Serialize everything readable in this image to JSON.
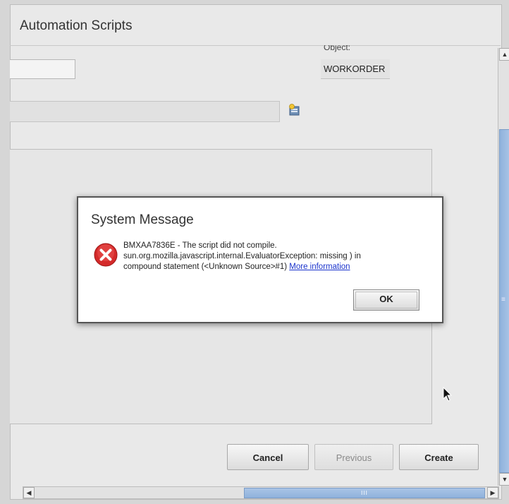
{
  "app": {
    "title": "Automation Scripts"
  },
  "form": {
    "object_label": "Object:",
    "object_value": "WORKORDER",
    "small_input_value": "",
    "wide_input_value": "",
    "source_text": ""
  },
  "footer": {
    "cancel_label": "Cancel",
    "previous_label": "Previous",
    "create_label": "Create"
  },
  "dialog": {
    "title": "System Message",
    "message_line1": "BMXAA7836E - The script did not compile.",
    "message_line2": "sun.org.mozilla.javascript.internal.EvaluatorException: missing ) in",
    "message_line3": "compound statement (<Unknown Source>#1)",
    "more_info_link": "More information",
    "ok_label": "OK"
  },
  "scrollbars": {
    "vertical_grip": "≡",
    "horizontal_grip": "III"
  },
  "colors": {
    "error_red": "#d42a2a",
    "link_blue": "#1a33cc",
    "scroll_thumb": "#8fb2dc"
  }
}
